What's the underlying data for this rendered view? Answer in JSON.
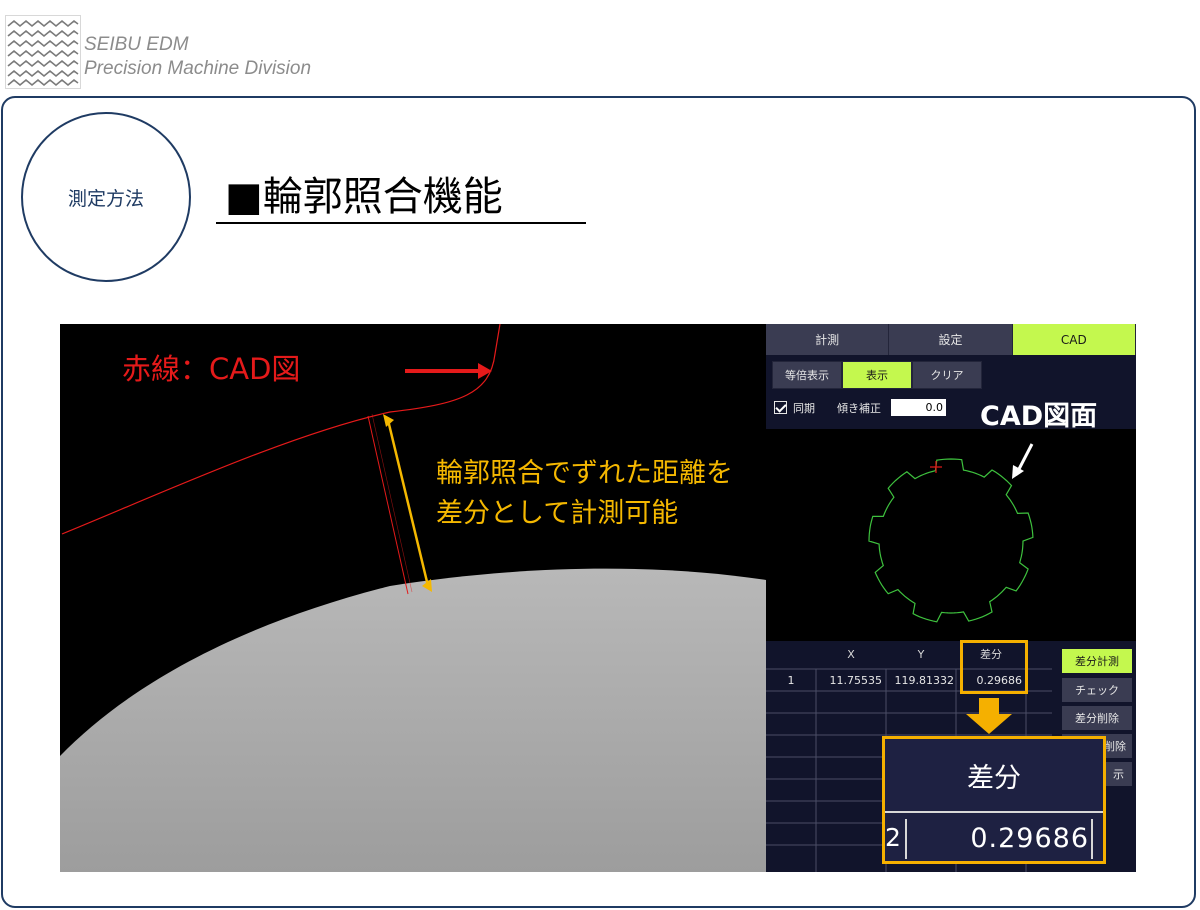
{
  "header": {
    "company_line1": "SEIBU EDM",
    "company_line2": "Precision Machine Division"
  },
  "section_badge": "測定方法",
  "slide_title": "■輪郭照合機能",
  "annotations": {
    "red_line_label": "赤線：CAD図",
    "distance_line1": "輪郭照合でずれた距離を",
    "distance_line2": "差分として計測可能",
    "cad_label": "CAD図面"
  },
  "panel": {
    "tabs": [
      {
        "label": "計測",
        "active": false
      },
      {
        "label": "設定",
        "active": false
      },
      {
        "label": "CAD",
        "active": true
      }
    ],
    "view_buttons": [
      {
        "label": "等倍表示",
        "active": false
      },
      {
        "label": "表示",
        "active": true
      },
      {
        "label": "クリア",
        "active": false
      }
    ],
    "sync_label": "同期",
    "sync_checked": true,
    "tilt_label": "傾き補正",
    "tilt_value": "0.0",
    "table": {
      "headers": [
        "X",
        "Y",
        "差分"
      ],
      "rows": [
        {
          "no": "1",
          "x": "11.75535",
          "y": "119.81332",
          "diff": "0.29686"
        }
      ]
    },
    "side_buttons": [
      {
        "label": "差分計測",
        "active": true
      },
      {
        "label": "チェック",
        "active": false
      },
      {
        "label": "差分削除",
        "active": false
      },
      {
        "label": "削除",
        "active": false
      },
      {
        "label": "示",
        "active": false
      }
    ]
  },
  "zoom": {
    "header": "差分",
    "row_no": "2",
    "value": "0.29686"
  },
  "colors": {
    "navy": "#1f3b63",
    "accent_green": "#c4f84e",
    "highlight_orange": "#f5b000",
    "cad_red": "#e51a1a",
    "cad_green": "#3ec13e"
  }
}
